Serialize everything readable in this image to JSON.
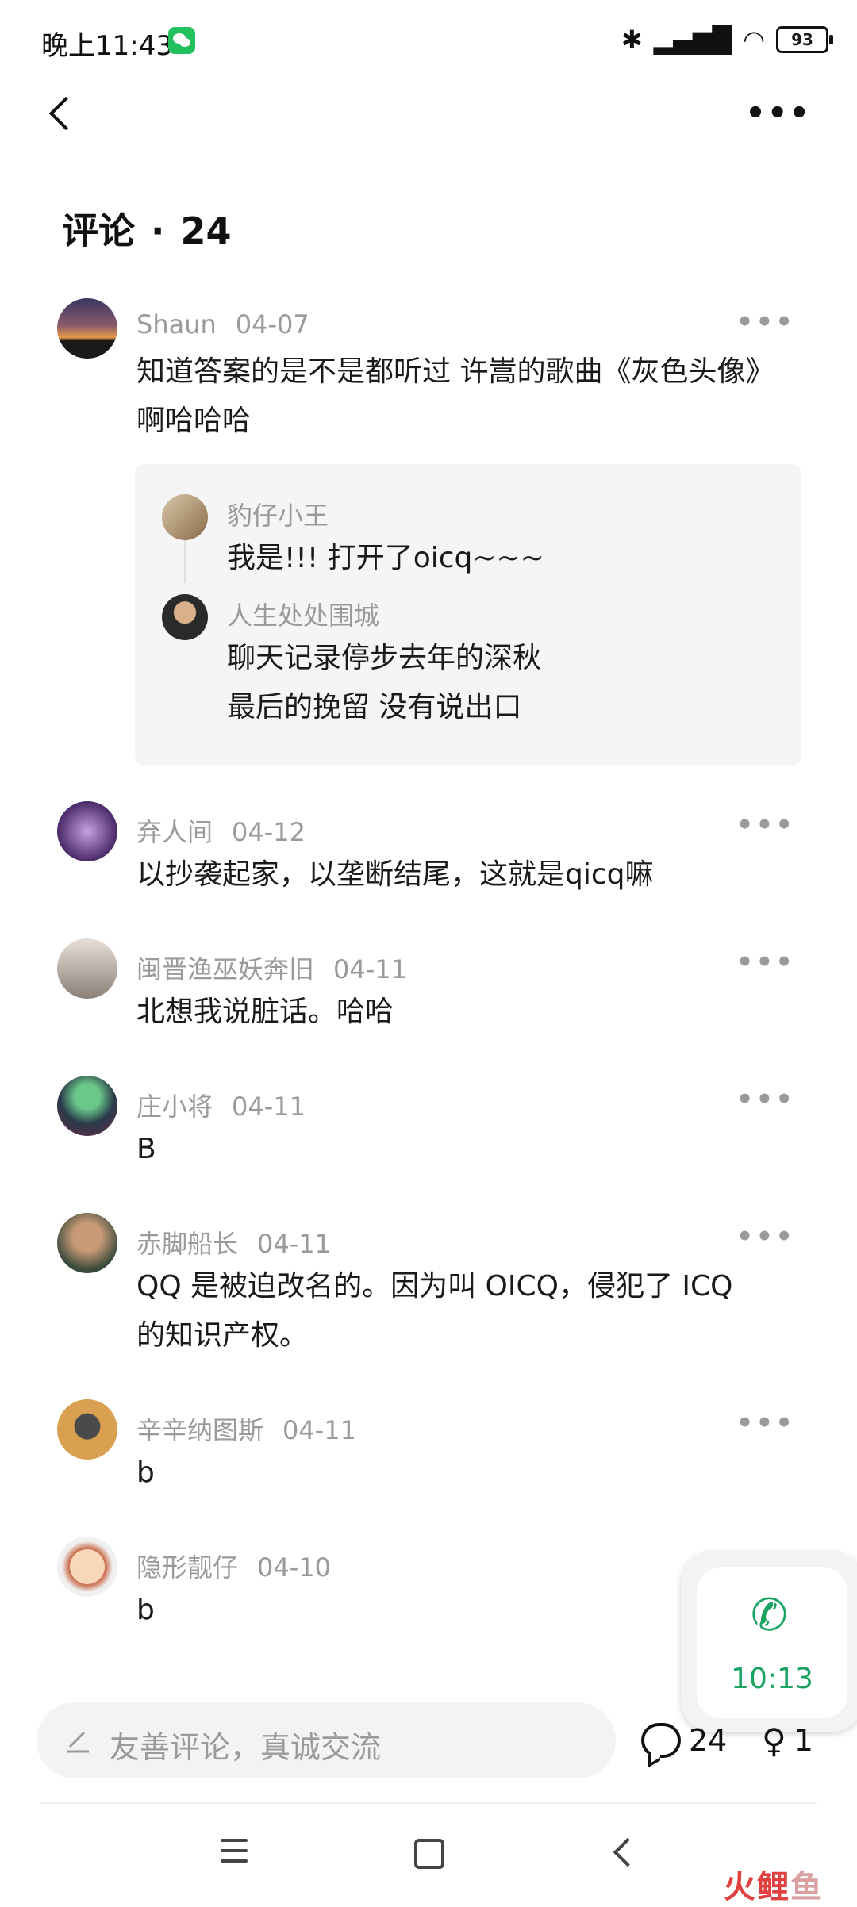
{
  "status_bar": {
    "time": "晚上11:43",
    "battery": "93"
  },
  "header": {
    "title": "评论",
    "separator": "·",
    "count": "24"
  },
  "comments": [
    {
      "user": "Shaun",
      "date": "04-07",
      "text": "知道答案的是不是都听过 许嵩的歌曲《灰色头像》\n啊哈哈哈"
    },
    {
      "user": "弃人间",
      "date": "04-12",
      "text": "以抄袭起家，以垄断结尾，这就是qicq嘛"
    },
    {
      "user": "闽晋渔巫妖奔旧",
      "date": "04-11",
      "text": "北想我说脏话。哈哈"
    },
    {
      "user": "庄小将",
      "date": "04-11",
      "text": "B"
    },
    {
      "user": "赤脚船长",
      "date": "04-11",
      "text": "QQ 是被迫改名的。因为叫 OICQ，侵犯了 ICQ\n的知识产权。"
    },
    {
      "user": "辛辛纳图斯",
      "date": "04-11",
      "text": "b"
    },
    {
      "user": "隐形靓仔",
      "date": "04-10",
      "text": "b"
    }
  ],
  "replies": [
    {
      "user": "豹仔小王",
      "text": "我是!!! 打开了oicq~~~"
    },
    {
      "user": "人生处处围城",
      "text": "聊天记录停步去年的深秋\n最后的挽留 没有说出口"
    }
  ],
  "floating_call": {
    "time": "10:13"
  },
  "bottom_bar": {
    "input_placeholder": "友善评论，真诚交流",
    "comment_count": "24",
    "like_count": "1"
  },
  "watermark": {
    "part1": "火鲤",
    "part2": "鱼"
  },
  "colors": {
    "accent_green": "#1aa260",
    "meta_gray": "#9a9a9a"
  }
}
